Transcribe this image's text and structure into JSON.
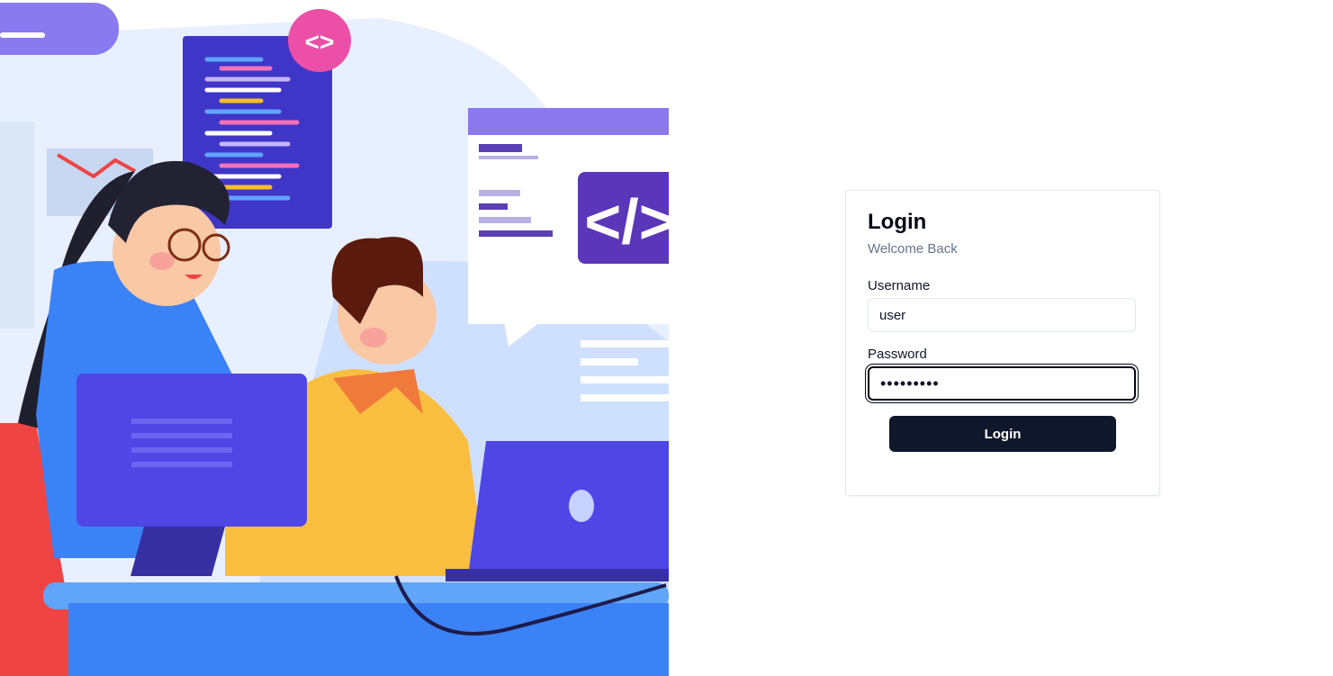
{
  "hero": {
    "icon": "developers-illustration",
    "code_glyph": "<>",
    "code_glyph_large": "</>"
  },
  "login": {
    "title": "Login",
    "subtitle": "Welcome Back",
    "username_label": "Username",
    "username_value": "user",
    "password_label": "Password",
    "password_value": "user12345",
    "submit_label": "Login"
  },
  "colors": {
    "button_bg": "#0f172a",
    "subtitle": "#64748b",
    "illustration_purple": "#5b4fd9",
    "illustration_blue": "#3b82f6",
    "illustration_yellow": "#f7b940"
  }
}
